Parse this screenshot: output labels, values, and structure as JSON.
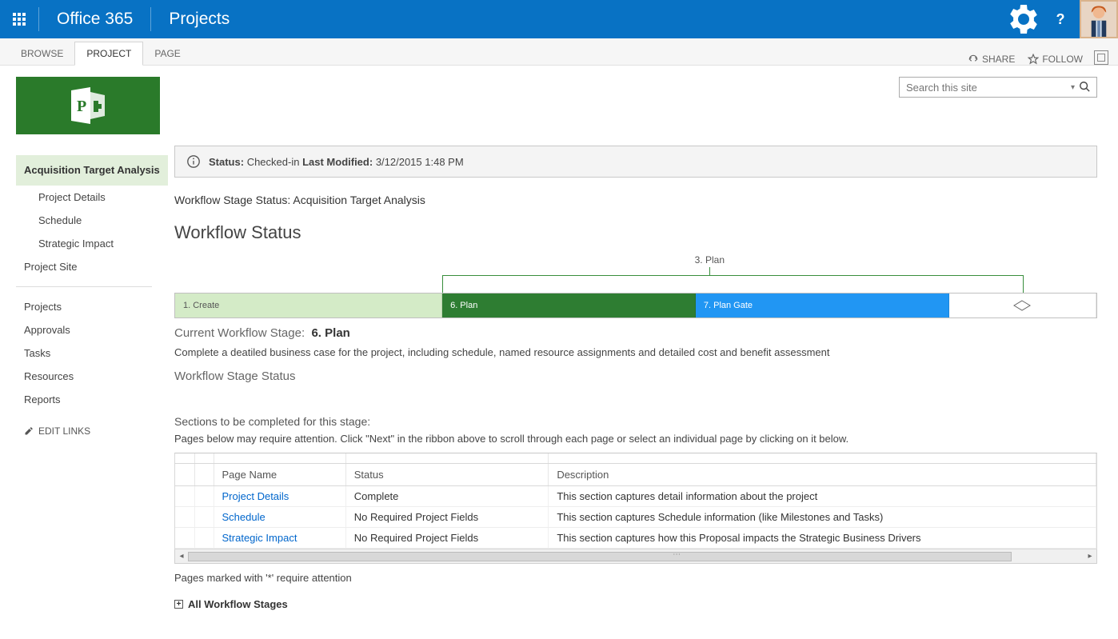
{
  "header": {
    "brand": "Office 365",
    "app": "Projects"
  },
  "ribbon": {
    "tabs": [
      "BROWSE",
      "PROJECT",
      "PAGE"
    ],
    "active_index": 1,
    "share": "SHARE",
    "follow": "FOLLOW"
  },
  "search": {
    "placeholder": "Search this site"
  },
  "nav": {
    "current_project": "Acquisition Target Analysis",
    "sub_items": [
      "Project Details",
      "Schedule",
      "Strategic Impact"
    ],
    "project_site": "Project Site",
    "global_items": [
      "Projects",
      "Approvals",
      "Tasks",
      "Resources",
      "Reports"
    ],
    "edit_links": "EDIT LINKS"
  },
  "status_bar": {
    "status_label": "Status:",
    "status_value": "Checked-in",
    "last_modified_label": "Last Modified:",
    "last_modified_value": "3/12/2015 1:48 PM"
  },
  "workflow": {
    "stage_status_line": "Workflow Stage Status: Acquisition Target Analysis",
    "status_heading": "Workflow Status",
    "top_label": "3. Plan",
    "cells": {
      "c1": "1. Create",
      "c2": "6. Plan",
      "c3": "7. Plan Gate"
    },
    "current_label": "Current Workflow Stage:",
    "current_value": "6. Plan",
    "description": "Complete a deatiled business case for the project, including schedule, named resource assignments and detailed cost and benefit assessment",
    "stage_status_sub": "Workflow Stage Status"
  },
  "sections": {
    "heading": "Sections to be completed for this stage:",
    "subtext": "Pages below may require attention. Click \"Next\" in the ribbon above to scroll through each page or select an individual page by clicking on it below.",
    "columns": [
      "Page Name",
      "Status",
      "Description"
    ],
    "rows": [
      {
        "page": "Project Details",
        "status": "Complete",
        "desc": "This section captures detail information about the project"
      },
      {
        "page": "Schedule",
        "status": "No Required Project Fields",
        "desc": "This section captures Schedule information (like Milestones and Tasks)"
      },
      {
        "page": "Strategic Impact",
        "status": "No Required Project Fields",
        "desc": "This section captures how this Proposal impacts the Strategic Business Drivers"
      }
    ],
    "footnote": "Pages marked with '*' require attention",
    "all_stages": "All Workflow Stages"
  }
}
